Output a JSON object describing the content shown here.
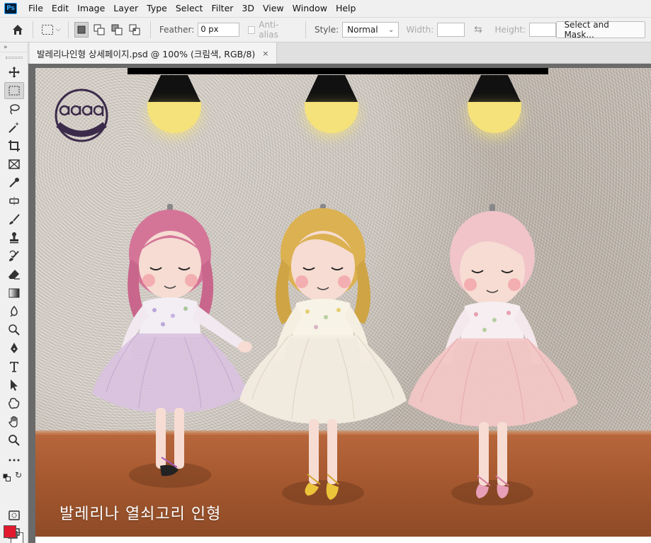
{
  "app": {
    "logo": "Ps"
  },
  "menu": [
    "File",
    "Edit",
    "Image",
    "Layer",
    "Type",
    "Select",
    "Filter",
    "3D",
    "View",
    "Window",
    "Help"
  ],
  "options": {
    "feather_label": "Feather:",
    "feather_value": "0 px",
    "antialias_label": "Anti-alias",
    "style_label": "Style:",
    "style_value": "Normal",
    "width_label": "Width:",
    "height_label": "Height:",
    "select_mask_label": "Select and Mask..."
  },
  "document": {
    "tab_title": "발레리나인형 상세페이지.psd @ 100% (크림색, RGB/8)",
    "close_glyph": "×"
  },
  "canvas": {
    "caption": "발레리나 열쇠고리 인형"
  },
  "colors": {
    "foreground": "#e31a2d",
    "background": "#ffffff",
    "bulb": "#f5e27a"
  },
  "tools": [
    "move-icon",
    "marquee-icon",
    "lasso-icon",
    "magic-wand-icon",
    "crop-icon",
    "frame-icon",
    "eyedropper-icon",
    "healing-icon",
    "brush-icon",
    "stamp-icon",
    "history-brush-icon",
    "eraser-icon",
    "gradient-icon",
    "blur-icon",
    "dodge-icon",
    "pen-icon",
    "type-icon",
    "path-select-icon",
    "shape-icon",
    "hand-icon",
    "zoom-icon",
    "more-icon"
  ]
}
